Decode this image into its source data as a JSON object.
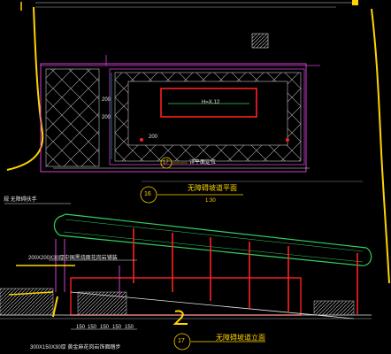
{
  "drawing": {
    "plan": {
      "title": "无障碍坡道平面",
      "scale": "1:30",
      "number": "16",
      "dim_200_a": "200",
      "dim_200_b": "200",
      "dim_200_c": "200",
      "rect_label": "H=X.12",
      "marker": "17",
      "marker_note": "详平面定位"
    },
    "elevation": {
      "title": "无障碍坡道立面",
      "number": "17",
      "note_left": "规 无障碍扶手",
      "note_tile": "200X200X30厚中国黑烧面花岗岩铺装",
      "note_bottom": "300X150X30厚 黄金麻花岗岩饰面踏步",
      "dims": [
        "150",
        "150",
        "150",
        "150",
        "150"
      ]
    }
  },
  "colors": {
    "background": "#000000",
    "yellow": "#ffd400",
    "magenta": "#d040d0",
    "red": "#ff2020",
    "green": "#30d060",
    "white": "#e6e6e6",
    "cyan": "#30c0d0"
  }
}
